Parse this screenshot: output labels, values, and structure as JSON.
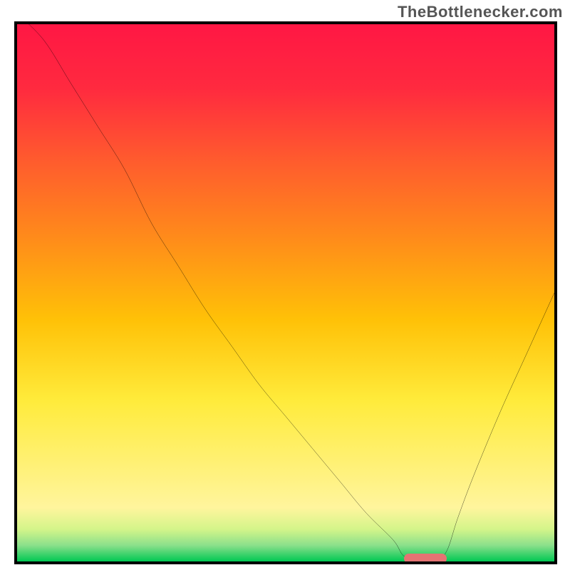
{
  "attribution": "TheBottlenecker.com",
  "chart_data": {
    "type": "line",
    "title": "",
    "xlabel": "",
    "ylabel": "",
    "xlim": [
      0,
      100
    ],
    "ylim": [
      0,
      100
    ],
    "x": [
      0,
      5,
      10,
      15,
      20,
      25,
      30,
      35,
      40,
      45,
      50,
      55,
      60,
      65,
      70,
      72,
      75,
      78,
      80,
      82,
      85,
      90,
      95,
      100
    ],
    "values": [
      105,
      97,
      89,
      81,
      73,
      63,
      55,
      47,
      40,
      33,
      27,
      21,
      15,
      9,
      4,
      1,
      0,
      0,
      2,
      8,
      16,
      28,
      39,
      50
    ],
    "marker": {
      "x_start": 72,
      "x_end": 80,
      "y": 0.5
    },
    "background_gradient": [
      {
        "offset": 0.0,
        "color": "#ff1744"
      },
      {
        "offset": 0.12,
        "color": "#ff2a3f"
      },
      {
        "offset": 0.25,
        "color": "#ff5a2e"
      },
      {
        "offset": 0.4,
        "color": "#ff8c1a"
      },
      {
        "offset": 0.55,
        "color": "#ffc107"
      },
      {
        "offset": 0.7,
        "color": "#ffeb3b"
      },
      {
        "offset": 0.82,
        "color": "#fff176"
      },
      {
        "offset": 0.9,
        "color": "#fff59d"
      },
      {
        "offset": 0.94,
        "color": "#d4f58a"
      },
      {
        "offset": 0.97,
        "color": "#8be08b"
      },
      {
        "offset": 1.0,
        "color": "#00c853"
      }
    ]
  }
}
